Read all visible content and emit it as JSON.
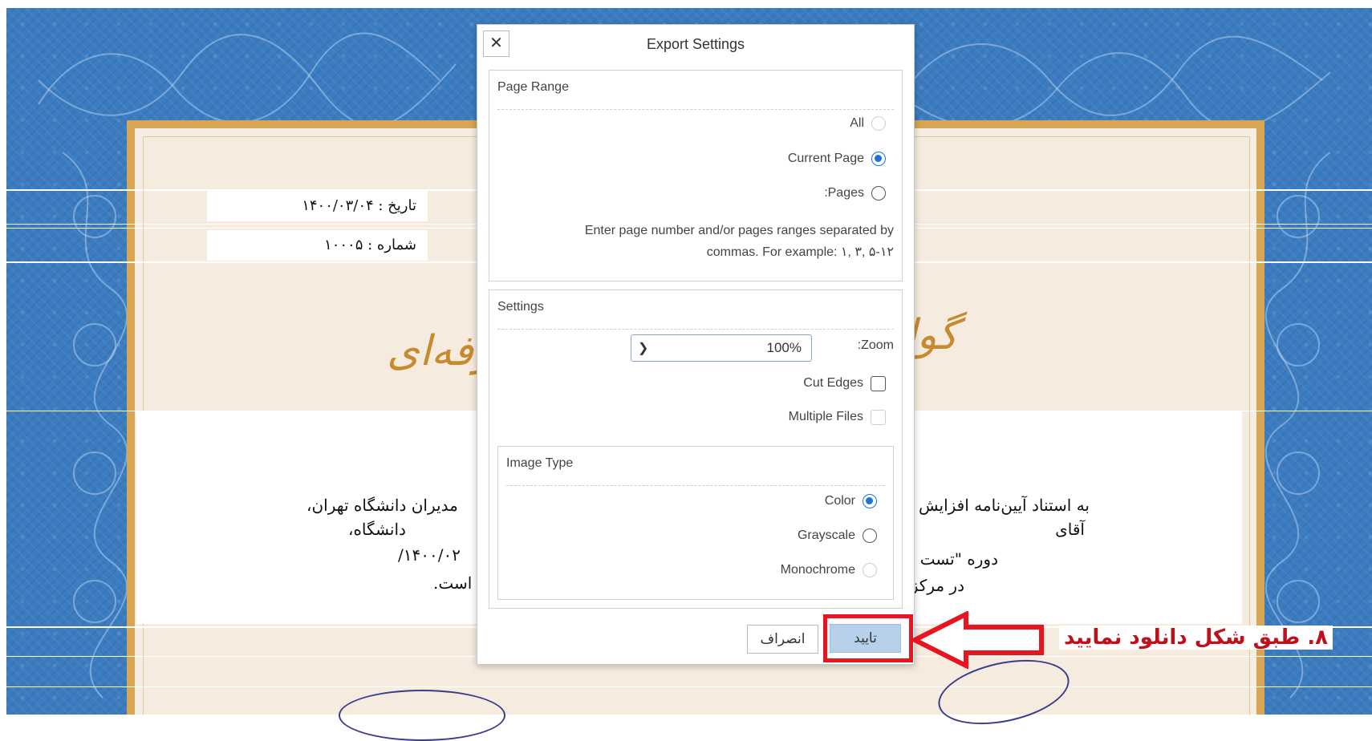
{
  "certificate": {
    "date_line": "تاریخ : ۱۴۰۰/۰۳/۰۴",
    "number_line": "شماره : ۱۰۰۰۵",
    "title_left": "رفه‌ای",
    "title_right": "گوا",
    "body_right_line1": "به استناد آیین‌نامه افزایش",
    "body_right_line2": "آقای",
    "body_right_line3": "دوره \"تست",
    "body_right_line4": "در مرکز",
    "body_left_line1": "مدیران دانشگاه تهران،",
    "body_left_line2": "دانشگاه،",
    "body_left_line3": "۱۴۰۰/۰۲/",
    "body_left_line4": "است."
  },
  "dialog": {
    "title": "Export Settings",
    "close_icon": "close-icon",
    "page_range": {
      "title": "Page Range",
      "options": [
        {
          "label": "All",
          "state": "disabled"
        },
        {
          "label": "Current Page",
          "state": "checked"
        },
        {
          "label": ":Pages",
          "state": "unchecked"
        }
      ],
      "hint_line1": "Enter page number and/or pages ranges separated by",
      "hint_line2": "commas. For example: ۱, ۳, ۵-۱۲"
    },
    "settings": {
      "title": "Settings",
      "zoom_label": ":Zoom",
      "zoom_value": "100%",
      "cut_edges_label": "Cut Edges",
      "multiple_files_label": "Multiple Files",
      "image_type": {
        "title": "Image Type",
        "options": [
          {
            "label": "Color",
            "state": "checked"
          },
          {
            "label": "Grayscale",
            "state": "unchecked"
          },
          {
            "label": "Monochrome",
            "state": "disabled"
          }
        ]
      }
    },
    "ok_label": "تایید",
    "cancel_label": "انصراف"
  },
  "annotation": {
    "label": "۸. طبق شکل دانلود نمایید",
    "color": "#e8141f"
  },
  "colors": {
    "background_blue": "#3b7bbf",
    "frame_gold": "#d8a552",
    "title_gold": "#c78a2e",
    "radio_blue": "#1e73d6",
    "ok_button": "#b8d1ea"
  }
}
